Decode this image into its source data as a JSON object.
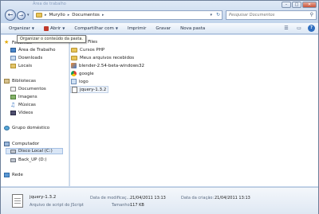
{
  "window": {
    "ghost_title": "Área de trabalho",
    "controls": {
      "minimize": "–",
      "maximize": "□",
      "close": "✕"
    }
  },
  "address": {
    "crumbs": [
      "Muryllo",
      "Documentos"
    ],
    "separator": "▸"
  },
  "search": {
    "placeholder": "Pesquisar Documentos"
  },
  "toolbar": {
    "organize": "Organizar",
    "open": "Abrir",
    "share": "Compartilhar com",
    "print": "Imprimir",
    "burn": "Gravar",
    "new_folder": "Nova pasta",
    "help": "?"
  },
  "tooltip": "Organizar o conteúdo da pasta.",
  "nav": {
    "favorites": "Favoritos",
    "desktop": "Área de Trabalho",
    "downloads": "Downloads",
    "places": "Locais",
    "libraries": "Bibliotecas",
    "documents": "Documentos",
    "pictures": "Imagens",
    "music": "Músicas",
    "videos": "Vídeos",
    "homegroup": "Grupo doméstico",
    "computer": "Computador",
    "local_disk": "Disco Local (C:)",
    "backup": "Back_UP (D:)",
    "network": "Rede"
  },
  "files": [
    {
      "name": "ll User Files"
    },
    {
      "name": "Cursos PHP"
    },
    {
      "name": "Meus arquivos recebidos"
    },
    {
      "name": "blender-2.54-beta-windows32"
    },
    {
      "name": "google"
    },
    {
      "name": "logo"
    },
    {
      "name": "jquery-1.3.2"
    }
  ],
  "details": {
    "name": "jquery-1.3.2",
    "type": "Arquivo de script do JScript",
    "modified_label": "Data de modificaç...",
    "modified_value": "21/04/2011 13:13",
    "created_label": "Data da criação:",
    "created_value": "21/04/2011 13:13",
    "size_label": "Tamanho:",
    "size_value": "117 KB"
  }
}
